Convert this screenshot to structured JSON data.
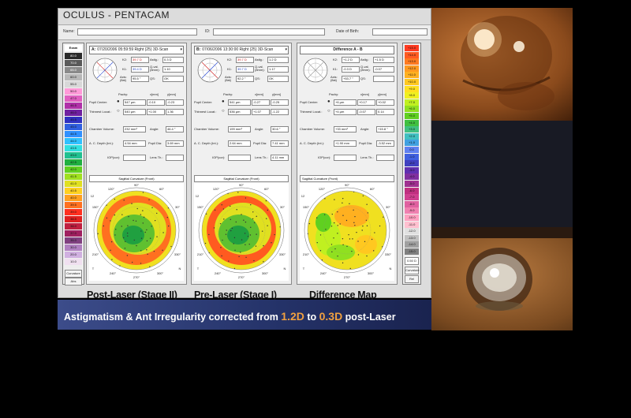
{
  "app": {
    "title": "OCULUS  -  PENTACAM"
  },
  "patient_bar": {
    "name_label": "Name:",
    "id_label": "ID:",
    "dob_label": "Date of Birth:"
  },
  "left_scale": {
    "header": "Exam",
    "values": [
      "80.0",
      "70.0",
      "65.0",
      "60.0",
      "55.0",
      "50.0",
      "47.0",
      "46.5",
      "46.0",
      "45.5",
      "45.0",
      "44.5",
      "44.0",
      "43.5",
      "43.0",
      "42.5",
      "42.0",
      "41.5",
      "41.0",
      "40.5",
      "40.0",
      "39.5",
      "39.0",
      "38.5",
      "38.0",
      "37.0",
      "35.0",
      "30.0",
      "20.0",
      "10.0"
    ],
    "curvature_label": "Curvature",
    "abs_label": "Abs"
  },
  "right_scale": {
    "values": [
      "+15.0",
      "+14.0",
      "+13.0",
      "+12.0",
      "+11.0",
      "+10.0",
      "+9.0",
      "+8.0",
      "+7.0",
      "+6.0",
      "+5.0",
      "+4.0",
      "+3.0",
      "+2.0",
      "+1.0",
      "0.0",
      "-1.0",
      "-2.0",
      "-3.0",
      "-4.0",
      "-5.0",
      "-6.0",
      "-7.0",
      "-8.0",
      "-9.0",
      "-10.0",
      "-11.0",
      "-12.0",
      "-13.0",
      "-14.0",
      "-15.0"
    ],
    "step_label": "0.50 D",
    "curvature_label": "Curvature",
    "rel_label": "Rel"
  },
  "panels": {
    "a": {
      "label": "A:",
      "exam": "07/20/2006  05:59:59  Right  (25) 3D-Scan",
      "k2_label": "K2:",
      "k2": "39.7 D",
      "astig_label": "Astig.:",
      "astig": "0.3 D",
      "k1_label": "K1:",
      "k1": "39.4 D",
      "qval_label": "Q-val. (8mm):",
      "qval": "1.10",
      "axis_label": "Axis: (flat)",
      "axis": "95.5 °",
      "qs_label": "QS:",
      "qs": "OK",
      "pachy_label": "Pachy:",
      "x_label": "x[mm]",
      "y_label": "y[mm]",
      "pupil_center_label": "Pupil Center:",
      "pupil_center": "547 µm",
      "pc_x": "-0.10",
      "pc_y": "-0.23",
      "thinnest_label": "Thinnest Locat.:",
      "thinnest": "540 µm",
      "th_x": "+1.00",
      "th_y": "1.36",
      "chamber_vol_label": "Chamber Volume:",
      "chamber_vol": "232 mm³",
      "angle_label": "Angle:",
      "angle": "46.4 °",
      "acd_label": "A. C. Depth (Int.):",
      "acd": "4.54 mm",
      "pupil_dia_label": "Pupil Dia:",
      "pupil_dia": "3.69 mm",
      "iop_label": "IOP(cor):",
      "lens_label": "Lens Th.:",
      "map_title": "Sagittal Curvature (Front)",
      "caption": "Post-Laser (Stage II)"
    },
    "b": {
      "label": "B:",
      "exam": "07/06/2006  13:30:00  Right  (25) 3D-Scan",
      "k2_label": "K2:",
      "k2": "39.7 D",
      "astig_label": "Astig.:",
      "astig": "1.2 D",
      "k1_label": "K1:",
      "k1": "39.7 D",
      "qval_label": "Q-val. (8mm):",
      "qval": "1.17",
      "axis_label": "Axis: (flat)",
      "axis": "92.2 °",
      "qs_label": "QS:",
      "qs": "OK",
      "pachy_label": "Pachy:",
      "x_label": "x[mm]",
      "y_label": "y[mm]",
      "pupil_center_label": "Pupil Center:",
      "pupil_center": "541 µm",
      "pc_x": "-0.27",
      "pc_y": "-0.25",
      "thinnest_label": "Thinnest Locat.:",
      "thinnest": "536 µm",
      "th_x": "+1.07",
      "th_y": "-1.22",
      "chamber_vol_label": "Chamber Volume:",
      "chamber_vol": "199 mm³",
      "angle_label": "Angle:",
      "angle": "30.6 °",
      "acd_label": "A. C. Depth (Int.):",
      "acd": "2.64 mm",
      "pupil_dia_label": "Pupil Dia:",
      "pupil_dia": "7.41 mm",
      "iop_label": "IOP(cor):",
      "lens_label": "Lens Th.:",
      "lens": "4.11 mm",
      "map_title": "Sagittal Curvature (Front)",
      "caption": "Pre-Laser (Stage I)"
    },
    "diff": {
      "label": "Difference A - B",
      "k2_label": "K2:",
      "k2": "+1.2 D",
      "astig_label": "Astig.:",
      "astig": "+1.5 D",
      "k1_label": "K1:",
      "k1": "-0.3 D",
      "qval_label": "Q-val. (8mm):",
      "qval": "-0.07",
      "axis_label": "Axis: (flat)",
      "axis": "+53.7 °",
      "qs_label": "QS:",
      "pachy_label": "Pachy:",
      "x_label": "x[mm]",
      "y_label": "y[mm]",
      "pupil_center_label": "Pupil Center:",
      "pupil_center": "+6 µm",
      "pc_x": "+0.17",
      "pc_y": "+0.02",
      "thinnest_label": "Thinnest Locat.:",
      "thinnest": "+4 µm",
      "th_x": "-0.07",
      "th_y": "0.14",
      "chamber_vol_label": "Chamber Volume:",
      "chamber_vol": "+33 mm³",
      "angle_label": "Angle:",
      "angle": "+15.8 °",
      "acd_label": "A. C. Depth (Int.):",
      "acd": "+1.90 mm",
      "pupil_dia_label": "Pupil Dia:",
      "pupil_dia": "-3.52 mm",
      "iop_label": "IOP(cor):",
      "lens_label": "Lens Th.:",
      "map_title": "Sagittal Curvature (Front)",
      "caption": "Difference Map"
    }
  },
  "map_labels": {
    "top": "90°",
    "tick": "12",
    "t": "T",
    "n": "N",
    "deg_120": "120°",
    "deg_60": "60°",
    "deg_150": "150°",
    "deg_30": "30°",
    "deg_210": "210°",
    "deg_330": "330°",
    "deg_240": "240°",
    "deg_300": "300°",
    "deg_270": "270°"
  },
  "banner": {
    "prefix": "Astigmatism & Ant Irregularity corrected from ",
    "from_value": "1.2D",
    "middle": " to ",
    "to_value": "0.3D",
    "suffix": " post-Laser"
  },
  "colors": {
    "screen_bg": "#dcdcdc",
    "banner_start": "#3c4c8a",
    "banner_end": "#1a234f",
    "highlight": "#f0a040"
  }
}
